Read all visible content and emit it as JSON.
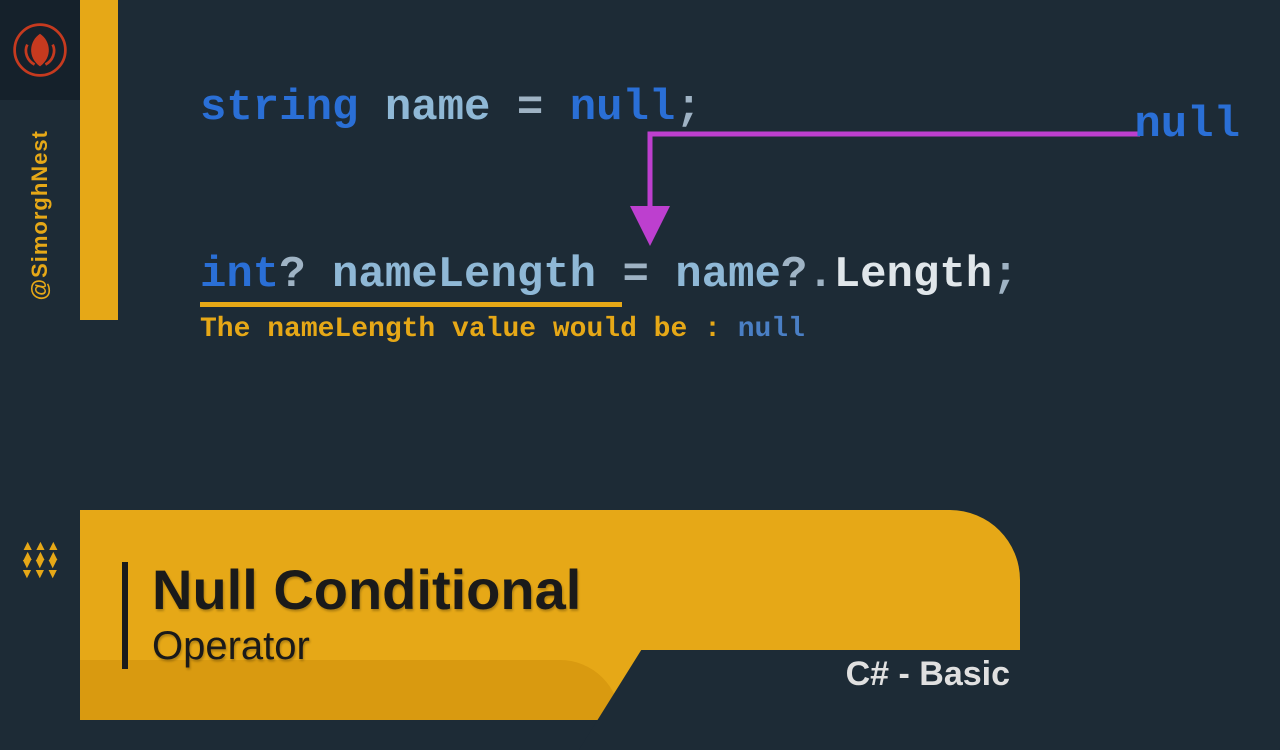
{
  "handle": "@SimorghNest",
  "code": {
    "line1": {
      "keyword": "string",
      "ident": "name",
      "eq": "=",
      "value": "null",
      "semi": ";"
    },
    "annotation_label": "null",
    "line2": {
      "keyword": "int",
      "nullable_mark": "?",
      "ident": "nameLength",
      "eq": "=",
      "rhs_ident": "name",
      "cond_op": "?.",
      "member": "Length",
      "semi": ";"
    },
    "explain_prefix": "The nameLength value would be : ",
    "explain_value": "null"
  },
  "banner": {
    "title": "Null Conditional",
    "subtitle": "Operator",
    "category": "C# - Basic"
  },
  "colors": {
    "accent": "#e6a817",
    "bg": "#1d2b36",
    "keyword": "#2a6fd6",
    "arrow": "#bd3fcf"
  }
}
